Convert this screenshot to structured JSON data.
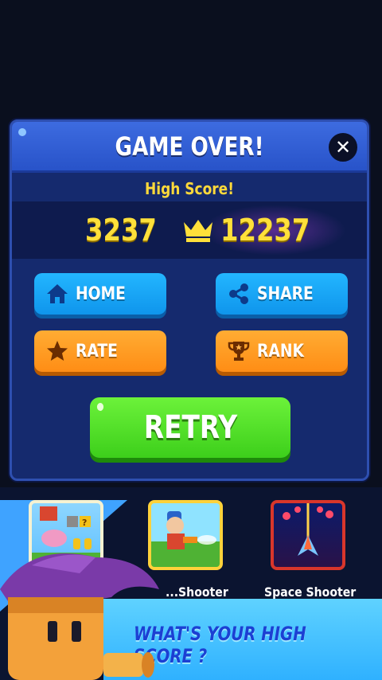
{
  "dialog": {
    "title": "GAME OVER!",
    "close_icon": "close-icon",
    "high_score_label": "High Score!",
    "current_score": "3237",
    "best_score": "12237",
    "best_icon": "crown-icon"
  },
  "buttons": {
    "home": {
      "label": "HOME",
      "icon": "home-icon"
    },
    "share": {
      "label": "SHARE",
      "icon": "share-icon"
    },
    "rate": {
      "label": "RATE",
      "icon": "star-icon"
    },
    "rank": {
      "label": "RANK",
      "icon": "trophy-icon"
    },
    "retry": {
      "label": "RETRY"
    }
  },
  "promo": {
    "games": [
      {
        "name": ""
      },
      {
        "name": "...Shooter"
      },
      {
        "name": "Space Shooter"
      }
    ],
    "tagline": "WHAT'S YOUR HIGH SCORE ?"
  },
  "colors": {
    "panel": "#152a6e",
    "header": "#2f5ad6",
    "score_yellow": "#ffe03a",
    "button_blue": "#1ea8f8",
    "button_orange": "#ff9a22",
    "retry_green": "#4fdc26"
  }
}
